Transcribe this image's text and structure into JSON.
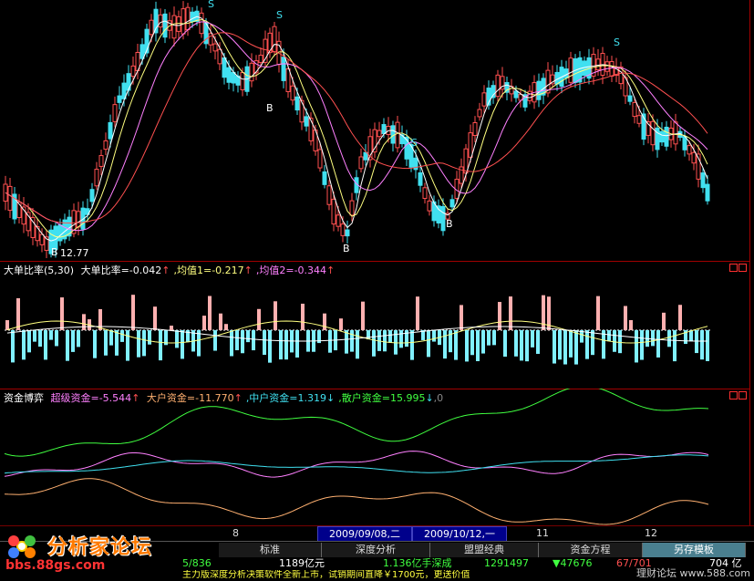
{
  "price_pane": {
    "low_label": "12.77",
    "marker_S": "S",
    "marker_B": "B",
    "colors": {
      "up": "#ff5050",
      "down": "#40e0f0",
      "ma5": "#ffffff",
      "ma10": "#ffff80",
      "ma20": "#ff80ff",
      "ma30": "#ff5050"
    }
  },
  "ratio_pane": {
    "name": "大单比率",
    "params": "(5,30)",
    "value_text": "大单比率=-0.042",
    "avg1_text": ",均值1=-0.217",
    "avg2_text": ",均值2=-0.344",
    "up_arrow": "↑"
  },
  "funds_pane": {
    "name": "资金博弈",
    "super_text": "超级资金=-5.544",
    "big_text": "大户资金=-11.770",
    "mid_text": ",中户资金=1.319",
    "retail_text": ",散户资金=15.995",
    "up_arrow": "↑",
    "down_arrow": "↓",
    "tail": ",0"
  },
  "axis": {
    "label_8": "8",
    "date1": "2009/09/08,二",
    "date2": "2009/10/12,一",
    "label_11": "11",
    "label_12": "12"
  },
  "tabs": [
    "标准",
    "深度分析",
    "盟盟经典",
    "资金方程",
    "另存模板"
  ],
  "status": {
    "partial1": "5/836",
    "amount": "1189亿元",
    "shz_vol": "1.136亿手深成",
    "index": "1291497",
    "change": "▼47676",
    "ratio": "67/701",
    "tail": "704 亿"
  },
  "ticker": "主力版深度分析决策软件全新上市，试销期间直降￥1700元，更送价值",
  "logo": {
    "cn": "分析家论坛",
    "url": "bbs.88gs.com"
  },
  "watermark": "理财论坛 www.588.com"
}
